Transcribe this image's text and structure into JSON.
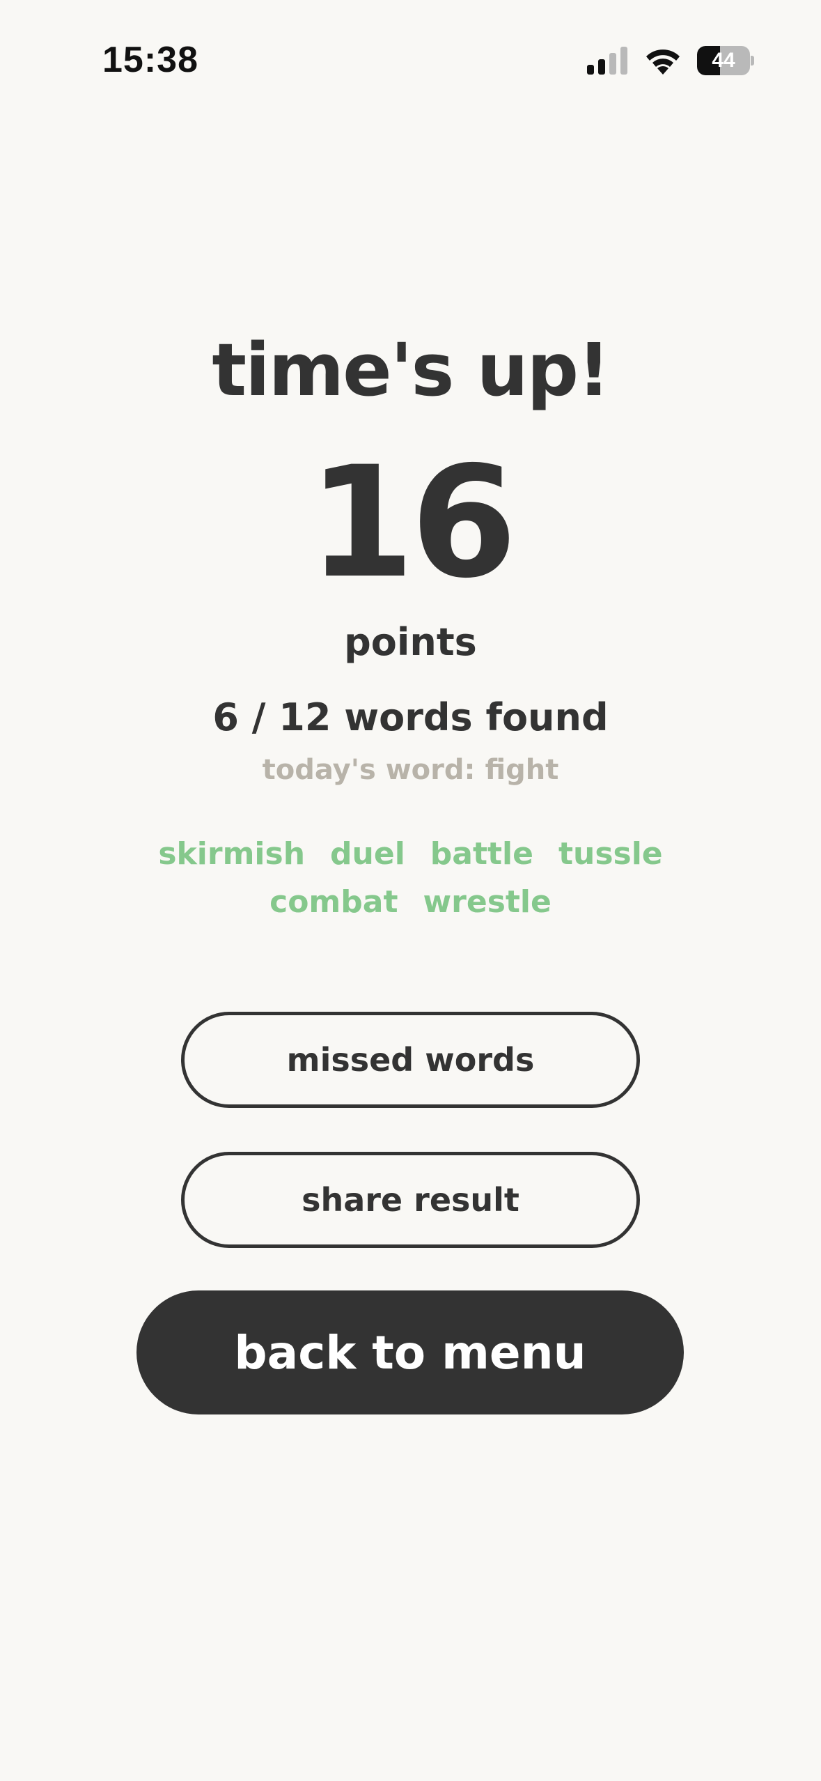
{
  "status_bar": {
    "time": "15:38",
    "battery_level": "44",
    "battery_fraction": 0.44,
    "signal_bars_active": 2,
    "signal_bars_total": 4
  },
  "results": {
    "title": "time's up!",
    "score": "16",
    "score_unit": "points",
    "words_found": "6 / 12 words found",
    "today_word": "today's word: fight",
    "found_words": [
      "skirmish",
      "duel",
      "battle",
      "tussle",
      "combat",
      "wrestle"
    ]
  },
  "actions": {
    "missed_words_label": "missed words",
    "share_result_label": "share result",
    "back_to_menu_label": "back to menu"
  },
  "colors": {
    "background": "#f9f8f5",
    "text": "#333333",
    "found_word": "#85c88c",
    "muted": "#b8b3a9",
    "primary_button": "#333333"
  }
}
